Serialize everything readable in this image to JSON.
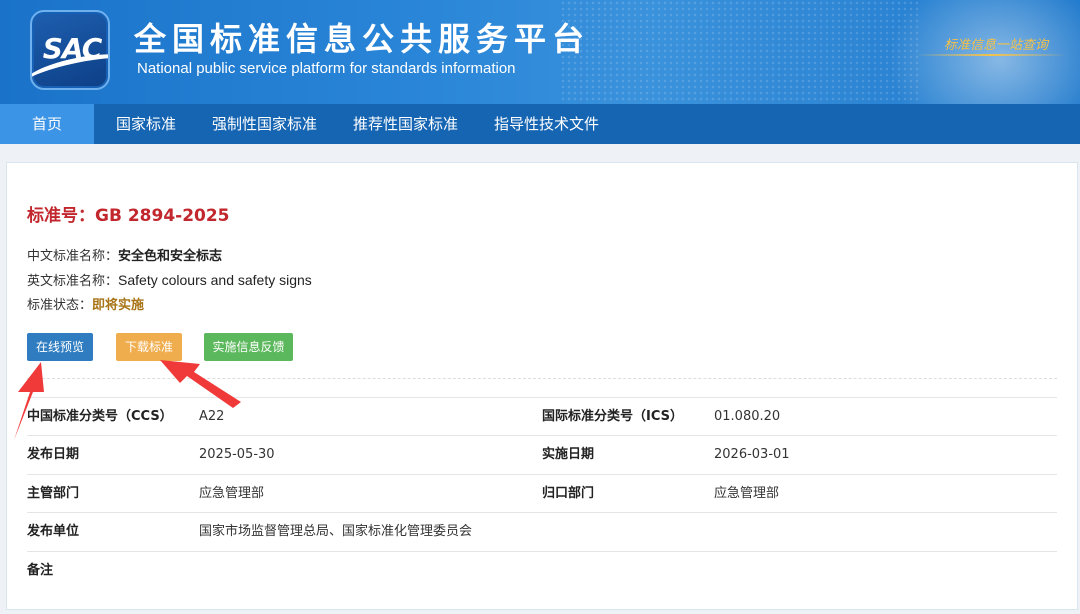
{
  "header": {
    "logo_text": "SAC",
    "title": "全国标准信息公共服务平台",
    "subtitle": "National public service platform  for standards information",
    "slogan": "标准信息一站查询"
  },
  "nav": {
    "items": [
      "首页",
      "国家标准",
      "强制性国家标准",
      "推荐性国家标准",
      "指导性技术文件"
    ],
    "active_index": 0
  },
  "standard": {
    "number_label": "标准号：",
    "number": "GB 2894-2025",
    "cn_name_label": "中文标准名称：",
    "cn_name": "安全色和安全标志",
    "en_name_label": "英文标准名称：",
    "en_name": "Safety colours and safety signs",
    "status_label": "标准状态：",
    "status": "即将实施"
  },
  "actions": {
    "preview": "在线预览",
    "download": "下载标准",
    "feedback": "实施信息反馈"
  },
  "details": {
    "ccs_label": "中国标准分类号（CCS）",
    "ccs": "A22",
    "ics_label": "国际标准分类号（ICS）",
    "ics": "01.080.20",
    "publish_date_label": "发布日期",
    "publish_date": "2025-05-30",
    "implement_date_label": "实施日期",
    "implement_date": "2026-03-01",
    "dept_label": "主管部门",
    "dept": "应急管理部",
    "central_dept_label": "归口部门",
    "central_dept": "应急管理部",
    "issuer_label": "发布单位",
    "issuer": "国家市场监督管理总局、国家标准化管理委员会",
    "remark_label": "备注",
    "remark": ""
  },
  "colors": {
    "banner": "#2a86d8",
    "nav": "#1665b3",
    "nav_active": "#3c94e6",
    "std_number": "#c1272d",
    "status": "#a87416",
    "btn_preview": "#2f7dc0",
    "btn_download": "#f0ad4e",
    "btn_feedback": "#5cb85c",
    "arrow": "#f03a3a"
  }
}
